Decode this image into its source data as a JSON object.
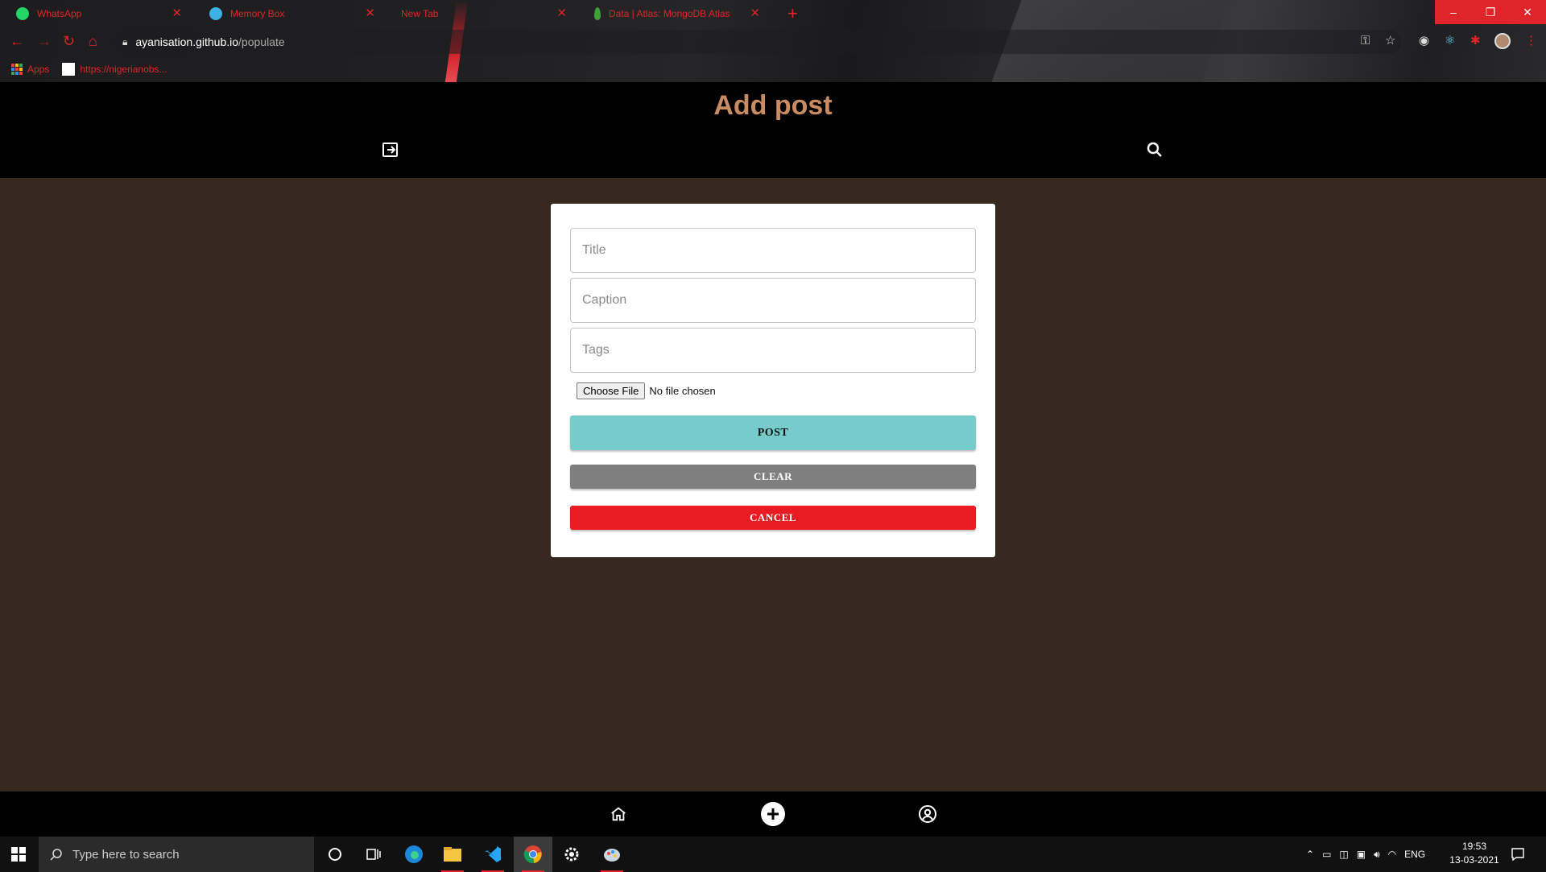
{
  "browser": {
    "tabs": [
      {
        "title": "WhatsApp",
        "favicon": "whatsapp-icon",
        "color": "#25d366"
      },
      {
        "title": "Memory Box",
        "favicon": "memory-box-icon",
        "color": "#3db1e3"
      },
      {
        "title": "New Tab",
        "favicon": "",
        "color": ""
      },
      {
        "title": "Data | Atlas: MongoDB Atlas",
        "favicon": "mongodb-leaf-icon",
        "color": "#3fa037"
      }
    ],
    "new_tab": "+",
    "url_host": "ayanisation.github.io",
    "url_path": "/populate",
    "bookmarks": [
      {
        "label": "Apps"
      },
      {
        "label": "https://nigerianobs..."
      }
    ],
    "accent_color": "#e0252a"
  },
  "app": {
    "page_title": "Add post",
    "title_color": "#c98c62",
    "background_color": "#372920"
  },
  "form": {
    "title_placeholder": "Title",
    "caption_placeholder": "Caption",
    "tags_placeholder": "Tags",
    "file_button": "Choose File",
    "file_status": "No file chosen",
    "post_label": "POST",
    "clear_label": "CLEAR",
    "cancel_label": "CANCEL",
    "post_color": "#78cbcb",
    "clear_color": "#7f7f7f",
    "cancel_color": "#ea1b23"
  },
  "bottom_nav": {
    "items": [
      {
        "name": "home",
        "icon": "home-icon"
      },
      {
        "name": "add",
        "icon": "add-circle-icon"
      },
      {
        "name": "account",
        "icon": "account-circle-icon"
      }
    ]
  },
  "taskbar": {
    "search_placeholder": "Type here to search",
    "language": "ENG",
    "time": "19:53",
    "date": "13-03-2021"
  }
}
